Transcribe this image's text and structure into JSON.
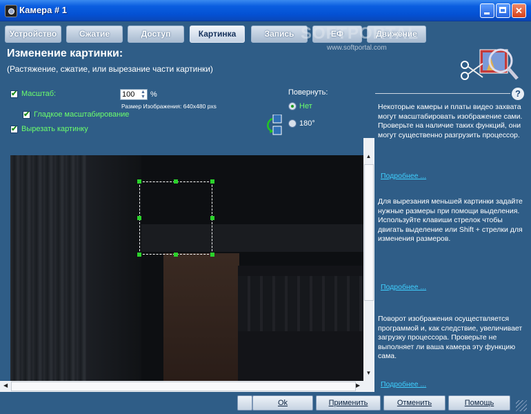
{
  "window": {
    "title": "Камера # 1"
  },
  "tabs": [
    {
      "label": "Устройство"
    },
    {
      "label": "Сжатие"
    },
    {
      "label": "Доступ"
    },
    {
      "label": "Картинка",
      "active": true
    },
    {
      "label": "Запись"
    },
    {
      "label": "ЕФ"
    },
    {
      "label": "Движение"
    }
  ],
  "watermark": {
    "logo": "SOFTPORTAL",
    "url": "www.softportal.com"
  },
  "header": {
    "title": "Изменение картинки:",
    "subtitle": "(Растяжение, сжатие, или вырезание части картинки)"
  },
  "controls": {
    "scale_label": "Масштаб:",
    "scale_value": "100",
    "scale_unit": "%",
    "image_size": "Размер Изображения: 640x480 pxs",
    "smooth_label": "Гладкое масштабирование",
    "crop_label": "Вырезать картинку",
    "rotate_label": "Повернуть:",
    "rotate_options": [
      "Нет",
      "180°"
    ]
  },
  "help": {
    "para1": "Некоторые камеры и платы видео захвата могут масштабировать изображение сами. Проверьте на наличие таких функций, они могут существенно разгрузить процессор.",
    "link1": "Подробнее ...",
    "para2": "Для вырезания меньшей картинки задайте нужные размеры при помощи выделения. Используйте клавиши стрелок чтобы двигать выделение или Shift + стрелки для изменения размеров.",
    "link2": "Подробнее ...",
    "para3": "Поворот изображения осуществляется программой и, как следствие, увеличивает загрузку процессора. Проверьте не выполняет ли ваша камера эту функцию сама.",
    "link3": "Подробнее ..."
  },
  "buttons": {
    "ok": "Ok",
    "apply": "Применить",
    "cancel": "Отменить",
    "help": "Помощь"
  },
  "colors": {
    "background": "#2f5d87",
    "label_green": "#6cff6c",
    "link": "#3fd0ff",
    "titlebar": "#0451d3"
  }
}
